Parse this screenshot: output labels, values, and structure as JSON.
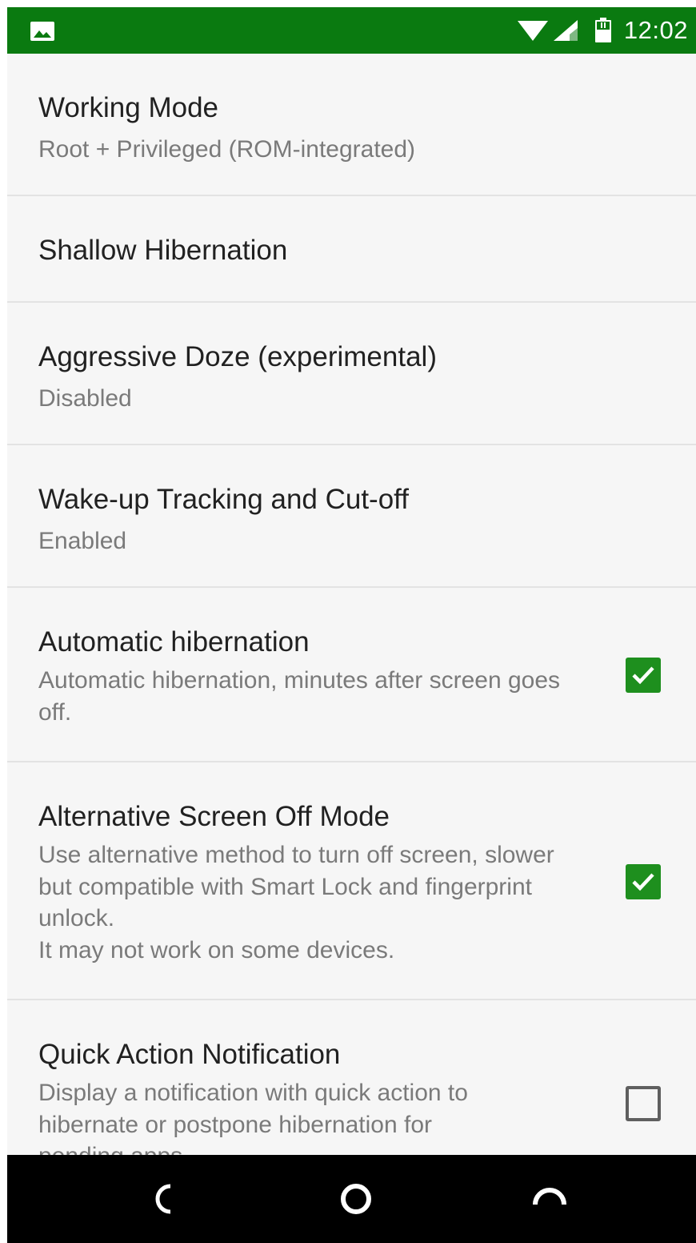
{
  "status_bar": {
    "time": "12:02",
    "left_icon": "image-notification-icon",
    "icons": [
      "wifi-icon",
      "signal-icon",
      "battery-icon"
    ],
    "background_color": "#0a7a10"
  },
  "settings": [
    {
      "title": "Working Mode",
      "summary": "Root + Privileged (ROM-integrated)"
    },
    {
      "title": "Shallow Hibernation"
    },
    {
      "title": "Aggressive Doze (experimental)",
      "summary": "Disabled"
    },
    {
      "title": "Wake-up Tracking and Cut-off",
      "summary": "Enabled"
    },
    {
      "title": "Automatic hibernation",
      "summary": "Automatic hibernation, minutes after screen goes off.",
      "checked": true
    },
    {
      "title": "Alternative Screen Off Mode",
      "summary": "Use alternative method to turn off screen, slower but compatible with Smart Lock and fingerprint unlock.\nIt may not work on some devices.",
      "checked": true
    },
    {
      "title": "Quick Action Notification",
      "summary": "Display a notification with quick action to hibernate or postpone hibernation for pending apps.",
      "checked": false
    }
  ],
  "nav_bar": {
    "buttons": [
      "back-icon",
      "home-icon",
      "recents-icon"
    ]
  },
  "colors": {
    "accent": "#1e8f1e",
    "title_text": "#212121",
    "summary_text": "#7a7a7a",
    "background": "#f6f6f6"
  }
}
